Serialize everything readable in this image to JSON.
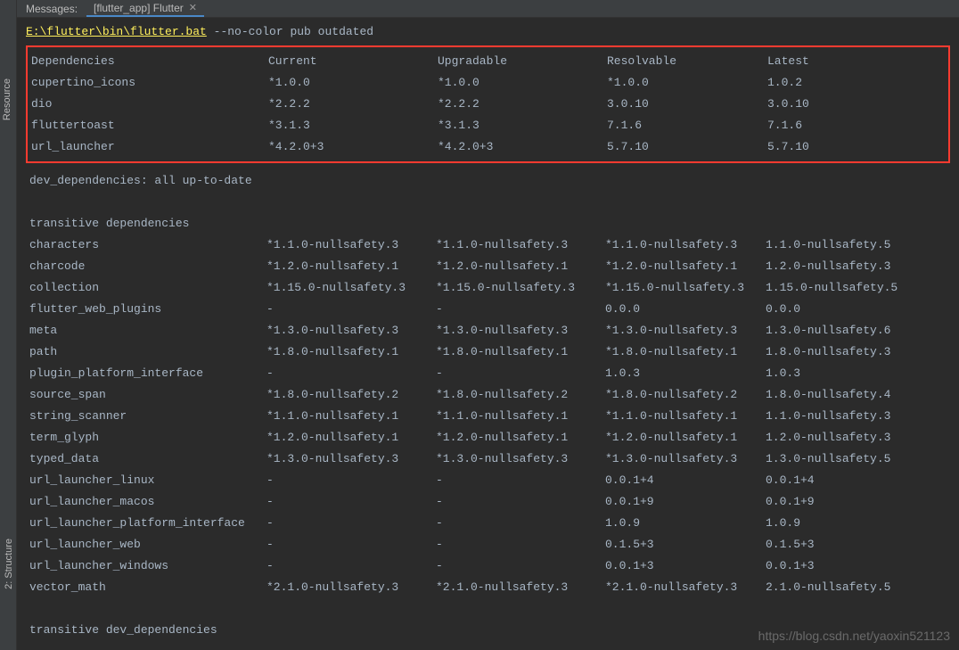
{
  "header": {
    "label": "Messages:",
    "tab_name": "[flutter_app] Flutter"
  },
  "sidebar": {
    "resource_tab": "Resource",
    "structure_tab": "2: Structure"
  },
  "command": {
    "path": "E:\\flutter\\bin\\flutter.bat",
    "args": " --no-color pub outdated"
  },
  "columns": {
    "name": "Dependencies",
    "current": "Current",
    "upgradable": "Upgradable",
    "resolvable": "Resolvable",
    "latest": "Latest"
  },
  "dependencies": [
    {
      "name": "cupertino_icons",
      "current": "*1.0.0",
      "upgradable": "*1.0.0",
      "resolvable": "*1.0.0",
      "latest": "1.0.2"
    },
    {
      "name": "dio",
      "current": "*2.2.2",
      "upgradable": "*2.2.2",
      "resolvable": "3.0.10",
      "latest": "3.0.10"
    },
    {
      "name": "fluttertoast",
      "current": "*3.1.3",
      "upgradable": "*3.1.3",
      "resolvable": "7.1.6",
      "latest": "7.1.6"
    },
    {
      "name": "url_launcher",
      "current": "*4.2.0+3",
      "upgradable": "*4.2.0+3",
      "resolvable": "5.7.10",
      "latest": "5.7.10"
    }
  ],
  "dev_dependencies_status": "dev_dependencies: all up-to-date",
  "transitive_header": "transitive dependencies",
  "transitive": [
    {
      "name": "characters",
      "current": "*1.1.0-nullsafety.3",
      "upgradable": "*1.1.0-nullsafety.3",
      "resolvable": "*1.1.0-nullsafety.3",
      "latest": "1.1.0-nullsafety.5"
    },
    {
      "name": "charcode",
      "current": "*1.2.0-nullsafety.1",
      "upgradable": "*1.2.0-nullsafety.1",
      "resolvable": "*1.2.0-nullsafety.1",
      "latest": "1.2.0-nullsafety.3"
    },
    {
      "name": "collection",
      "current": "*1.15.0-nullsafety.3",
      "upgradable": "*1.15.0-nullsafety.3",
      "resolvable": "*1.15.0-nullsafety.3",
      "latest": "1.15.0-nullsafety.5"
    },
    {
      "name": "flutter_web_plugins",
      "current": "-",
      "upgradable": "-",
      "resolvable": "0.0.0",
      "latest": "0.0.0"
    },
    {
      "name": "meta",
      "current": "*1.3.0-nullsafety.3",
      "upgradable": "*1.3.0-nullsafety.3",
      "resolvable": "*1.3.0-nullsafety.3",
      "latest": "1.3.0-nullsafety.6"
    },
    {
      "name": "path",
      "current": "*1.8.0-nullsafety.1",
      "upgradable": "*1.8.0-nullsafety.1",
      "resolvable": "*1.8.0-nullsafety.1",
      "latest": "1.8.0-nullsafety.3"
    },
    {
      "name": "plugin_platform_interface",
      "current": "-",
      "upgradable": "-",
      "resolvable": "1.0.3",
      "latest": "1.0.3"
    },
    {
      "name": "source_span",
      "current": "*1.8.0-nullsafety.2",
      "upgradable": "*1.8.0-nullsafety.2",
      "resolvable": "*1.8.0-nullsafety.2",
      "latest": "1.8.0-nullsafety.4"
    },
    {
      "name": "string_scanner",
      "current": "*1.1.0-nullsafety.1",
      "upgradable": "*1.1.0-nullsafety.1",
      "resolvable": "*1.1.0-nullsafety.1",
      "latest": "1.1.0-nullsafety.3"
    },
    {
      "name": "term_glyph",
      "current": "*1.2.0-nullsafety.1",
      "upgradable": "*1.2.0-nullsafety.1",
      "resolvable": "*1.2.0-nullsafety.1",
      "latest": "1.2.0-nullsafety.3"
    },
    {
      "name": "typed_data",
      "current": "*1.3.0-nullsafety.3",
      "upgradable": "*1.3.0-nullsafety.3",
      "resolvable": "*1.3.0-nullsafety.3",
      "latest": "1.3.0-nullsafety.5"
    },
    {
      "name": "url_launcher_linux",
      "current": "-",
      "upgradable": "-",
      "resolvable": "0.0.1+4",
      "latest": "0.0.1+4"
    },
    {
      "name": "url_launcher_macos",
      "current": "-",
      "upgradable": "-",
      "resolvable": "0.0.1+9",
      "latest": "0.0.1+9"
    },
    {
      "name": "url_launcher_platform_interface",
      "current": "-",
      "upgradable": "-",
      "resolvable": "1.0.9",
      "latest": "1.0.9"
    },
    {
      "name": "url_launcher_web",
      "current": "-",
      "upgradable": "-",
      "resolvable": "0.1.5+3",
      "latest": "0.1.5+3"
    },
    {
      "name": "url_launcher_windows",
      "current": "-",
      "upgradable": "-",
      "resolvable": "0.0.1+3",
      "latest": "0.0.1+3"
    },
    {
      "name": "vector_math",
      "current": "*2.1.0-nullsafety.3",
      "upgradable": "*2.1.0-nullsafety.3",
      "resolvable": "*2.1.0-nullsafety.3",
      "latest": "2.1.0-nullsafety.5"
    }
  ],
  "transitive_dev_header": "transitive dev_dependencies",
  "watermark": "https://blog.csdn.net/yaoxin521123"
}
